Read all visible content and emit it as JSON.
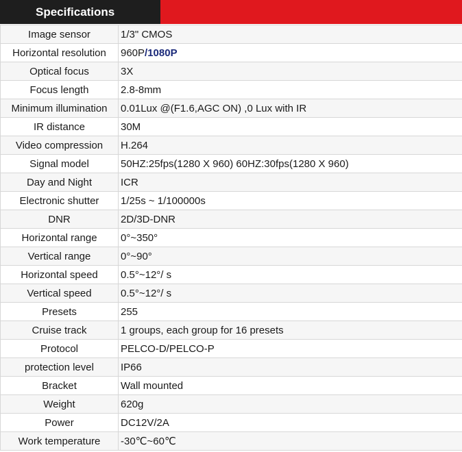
{
  "header": {
    "title": "Specifications"
  },
  "specs": [
    {
      "label": "Image sensor",
      "value": "1/3\" CMOS"
    },
    {
      "label": "Horizontal resolution",
      "value": "960P",
      "value_accent": "/1080P"
    },
    {
      "label": "Optical focus",
      "value": "3X"
    },
    {
      "label": "Focus length",
      "value": "2.8-8mm"
    },
    {
      "label": "Minimum illumination",
      "value": "0.01Lux @(F1.6,AGC ON) ,0 Lux with IR"
    },
    {
      "label": "IR distance",
      "value": "30M"
    },
    {
      "label": "Video compression",
      "value": "H.264"
    },
    {
      "label": "Signal model",
      "value": "50HZ:25fps(1280 X 960) 60HZ:30fps(1280 X 960)"
    },
    {
      "label": "Day and Night",
      "value": "ICR"
    },
    {
      "label": "Electronic shutter",
      "value": "1/25s ~ 1/100000s"
    },
    {
      "label": "DNR",
      "value": "2D/3D-DNR"
    },
    {
      "label": "Horizontal range",
      "value": "0°~350°"
    },
    {
      "label": "Vertical range",
      "value": "0°~90°"
    },
    {
      "label": "Horizontal speed",
      "value": "0.5°~12°/ s"
    },
    {
      "label": "Vertical speed",
      "value": "0.5°~12°/ s"
    },
    {
      "label": "Presets",
      "value": "255"
    },
    {
      "label": "Cruise track",
      "value": "1 groups, each group for 16 presets"
    },
    {
      "label": "Protocol",
      "value": "PELCO-D/PELCO-P"
    },
    {
      "label": "protection level",
      "value": "IP66"
    },
    {
      "label": "Bracket",
      "value": "Wall mounted"
    },
    {
      "label": "Weight",
      "value": "620g"
    },
    {
      "label": "Power",
      "value": "DC12V/2A"
    },
    {
      "label": "Work temperature",
      "value": "-30℃~60℃"
    }
  ],
  "colors": {
    "header_dark": "#1e1e1e",
    "header_red": "#e0181e",
    "accent_text": "#1b2a7a"
  }
}
